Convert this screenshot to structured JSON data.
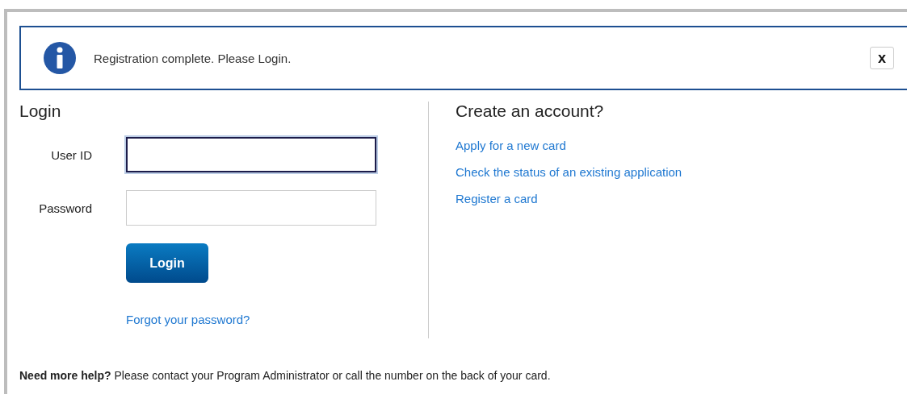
{
  "alert": {
    "message": "Registration complete. Please Login.",
    "close_label": "x"
  },
  "login": {
    "title": "Login",
    "fields": [
      {
        "label": "User ID",
        "focused": true
      },
      {
        "label": "Password",
        "focused": false
      }
    ],
    "button": "Login",
    "forgot_link": "Forgot your password?"
  },
  "create_account": {
    "title": "Create an account?",
    "links": [
      "Apply for a new card",
      "Check the status of an existing application",
      "Register a card"
    ]
  },
  "help": "**Need more help?**  Please contact your Program Administrator or call the number on the back of your card."
}
